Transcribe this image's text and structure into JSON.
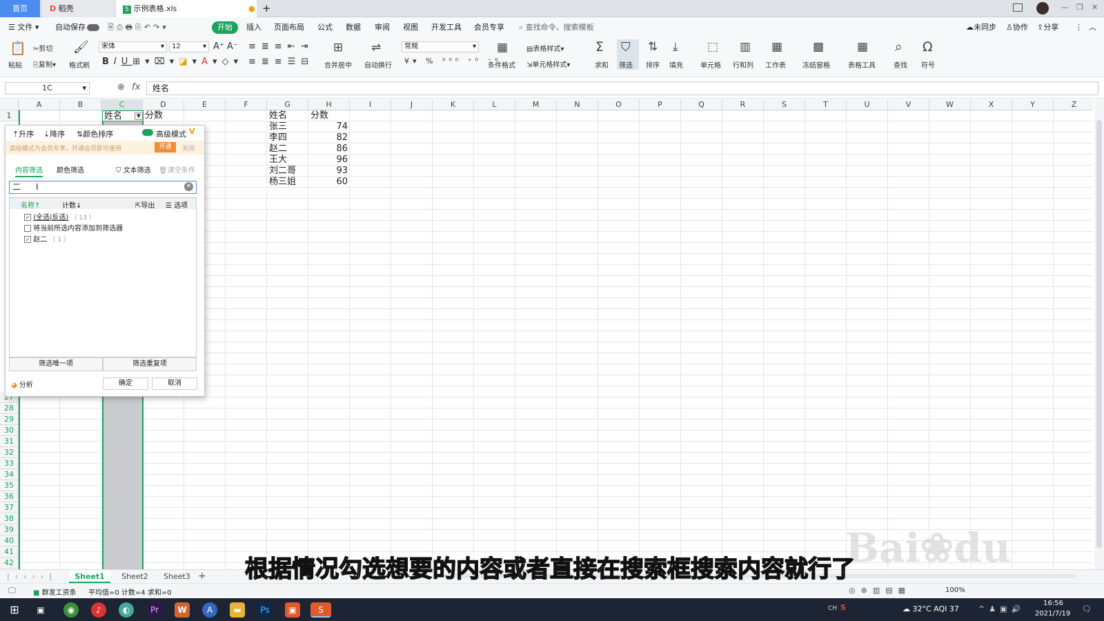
{
  "tabs": {
    "home": "首页",
    "docer": "稻壳",
    "file": "示例表格.xls",
    "add": "+"
  },
  "menu": {
    "file": "文件",
    "autosave": "自动保存",
    "items": [
      "开始",
      "插入",
      "页面布局",
      "公式",
      "数据",
      "审阅",
      "视图",
      "开发工具",
      "会员专享"
    ],
    "search": "查找命令、搜索模板",
    "unsynced": "未同步",
    "collab": "协作",
    "share": "分享"
  },
  "ribbon": {
    "paste": "粘贴",
    "cut": "剪切",
    "copy": "复制",
    "format_painter": "格式刷",
    "font": "宋体",
    "font_size": "12",
    "merge": "合并居中",
    "wrap": "自动换行",
    "number_format": "常规",
    "cond_format": "条件格式",
    "table_style": "表格样式",
    "cell_style": "单元格样式",
    "sum": "求和",
    "filter": "筛选",
    "sort": "排序",
    "fill": "填充",
    "cell": "单元格",
    "row_col": "行和列",
    "worksheet": "工作表",
    "freeze": "冻结窗格",
    "table_tools": "表格工具",
    "find": "查找",
    "symbol": "符号"
  },
  "formula_bar": {
    "name_box": "1C",
    "fx": "fx",
    "content": "姓名"
  },
  "columns": [
    "A",
    "B",
    "C",
    "D",
    "E",
    "F",
    "G",
    "H",
    "I",
    "J",
    "K",
    "L",
    "M",
    "N",
    "O",
    "P",
    "Q",
    "R",
    "S",
    "T",
    "U",
    "V",
    "W",
    "X",
    "Y",
    "Z"
  ],
  "rows_top": [
    "1"
  ],
  "rows_bottom": [
    "27",
    "28",
    "29",
    "30",
    "31",
    "32",
    "33",
    "34",
    "35",
    "36",
    "37",
    "38",
    "39",
    "40",
    "41",
    "42"
  ],
  "cells": {
    "c1": "姓名",
    "d1": "分数",
    "g_header": "姓名",
    "h_header": "分数",
    "data": [
      {
        "name": "张三",
        "score": "74"
      },
      {
        "name": "李四",
        "score": "82"
      },
      {
        "name": "赵二",
        "score": "86"
      },
      {
        "name": "王大",
        "score": "96"
      },
      {
        "name": "刘二哥",
        "score": "93"
      },
      {
        "name": "杨三姐",
        "score": "60"
      }
    ]
  },
  "filter_panel": {
    "asc": "升序",
    "desc": "降序",
    "color_sort": "颜色排序",
    "advanced": "高级模式",
    "vip_note": "高级模式为会员专享，开通会员即可使用",
    "open": "开通",
    "close": "关闭",
    "tab_content": "内容筛选",
    "tab_color": "颜色筛选",
    "text_filter": "文本筛选",
    "clear": "清空条件",
    "search_value": "二",
    "col_name": "名称↑",
    "col_count": "计数↓",
    "export": "导出",
    "options": "选项",
    "items": [
      {
        "label": "(全选|反选)",
        "count": "（ 13 ）",
        "checked": true
      },
      {
        "label": "将当前所选内容添加到筛选器",
        "count": "",
        "checked": false
      },
      {
        "label": "赵二",
        "count": "（ 1 ）",
        "checked": true
      }
    ],
    "unique": "筛选唯一项",
    "dupes": "筛选重复项",
    "analyze": "分析",
    "ok": "确定",
    "cancel": "取消"
  },
  "sheets": [
    "Sheet1",
    "Sheet2",
    "Sheet3"
  ],
  "status": {
    "tool": "群发工资条",
    "summary": "平均值=0  计数=4  求和=0",
    "zoom": "100%"
  },
  "taskbar": {
    "weather": "32°C  AQI 37",
    "ime": "CH",
    "time": "16:56",
    "date": "2021/7/19"
  },
  "caption": "根据情况勾选想要的内容或者直接在搜索框搜索内容就行了",
  "colors": {
    "accent": "#1aa35a",
    "tab_active": "#4a8cf0"
  }
}
